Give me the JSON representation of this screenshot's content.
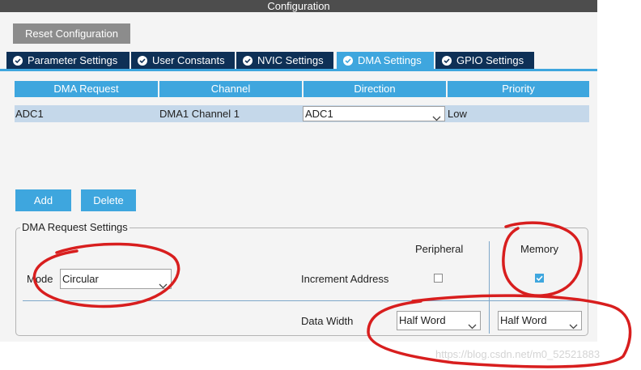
{
  "window": {
    "title": "Configuration"
  },
  "toolbar": {
    "reset_label": "Reset Configuration"
  },
  "tabs": [
    {
      "label": "Parameter Settings",
      "active": false
    },
    {
      "label": "User Constants",
      "active": false
    },
    {
      "label": "NVIC Settings",
      "active": false
    },
    {
      "label": "DMA Settings",
      "active": true
    },
    {
      "label": "GPIO Settings",
      "active": false
    }
  ],
  "dma_table": {
    "headers": [
      "DMA Request",
      "Channel",
      "Direction",
      "Priority"
    ],
    "rows": [
      {
        "request": "ADC1",
        "channel": "DMA1 Channel 1",
        "direction": "ADC1",
        "priority": "Low"
      }
    ]
  },
  "actions": {
    "add_label": "Add",
    "delete_label": "Delete"
  },
  "request_settings": {
    "group_title": "DMA Request Settings",
    "mode_label": "Mode",
    "mode_value": "Circular",
    "peripheral_header": "Peripheral",
    "memory_header": "Memory",
    "increment_label": "Increment Address",
    "peripheral_increment": false,
    "memory_increment": true,
    "data_width_label": "Data Width",
    "peripheral_width": "Half Word",
    "memory_width": "Half Word"
  },
  "watermark": "https://blog.csdn.net/m0_52521883",
  "colors": {
    "accent": "#3ea6de",
    "tab_dark": "#0e3056",
    "title_bar": "#4d4d4d",
    "annotation": "#d81e1e"
  }
}
